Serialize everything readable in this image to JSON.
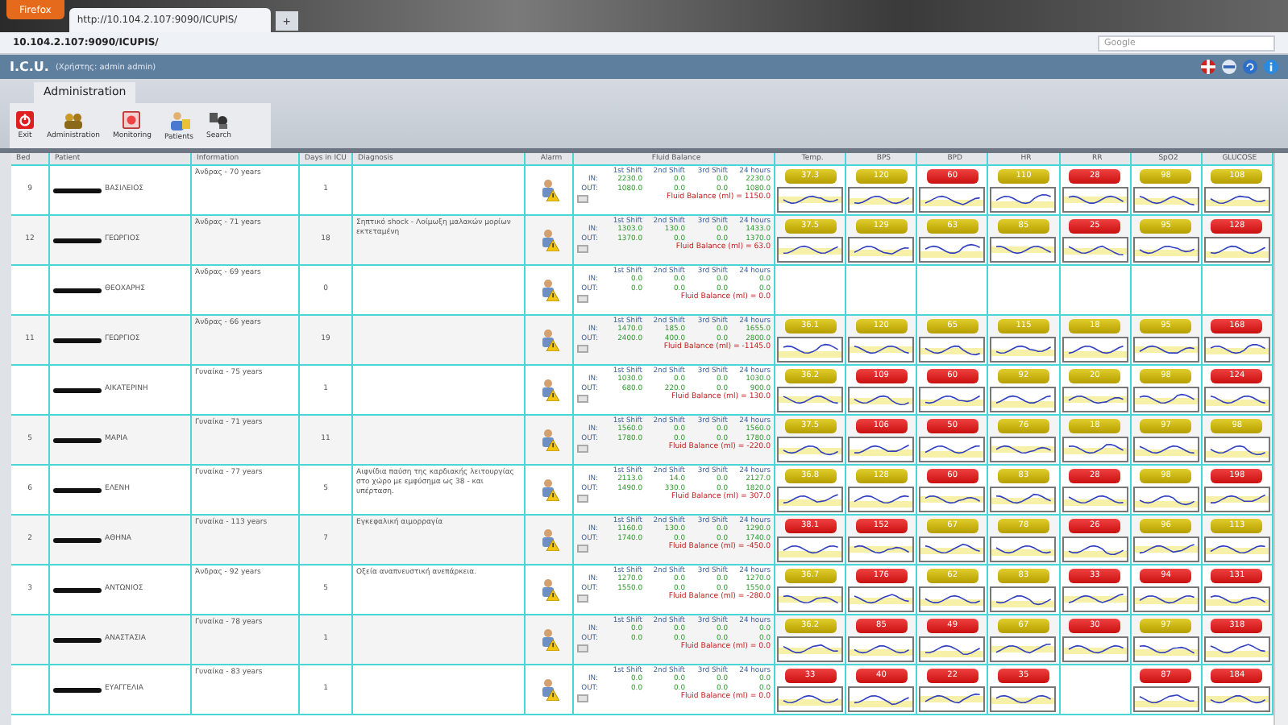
{
  "browser": {
    "menu_button": "Firefox",
    "tab_title": "http://10.104.2.107:9090/ICUPIS/",
    "new_tab": "+",
    "url": "10.104.2.107:9090/ICUPIS/",
    "search_placeholder": "Google"
  },
  "app": {
    "title": "I.C.U.",
    "user": "(Χρήστης: admin admin)"
  },
  "ribbon": {
    "tab": "Administration",
    "buttons": [
      {
        "label": "Exit",
        "kind": "exit"
      },
      {
        "label": "Administration",
        "kind": "admin"
      },
      {
        "label": "Monitoring",
        "kind": "monitoring"
      },
      {
        "label": "Patients",
        "kind": "patients"
      },
      {
        "label": "Search",
        "kind": "search"
      }
    ]
  },
  "table": {
    "columns": [
      "Bed",
      "Patient",
      "Information",
      "Days in ICU",
      "Diagnosis",
      "Alarm",
      "Fluid Balance",
      "Temp.",
      "BPS",
      "BPD",
      "HR",
      "RR",
      "SpO2",
      "GLUCOSE"
    ],
    "rows": [
      {
        "bed": "9",
        "patient": "ΒΑΣΙΛΕΙΟΣ",
        "info": "Άνδρας - 70 years",
        "days": "1",
        "fluid": {
          "shifts": [
            "1st Shift",
            "2nd Shift",
            "3rd Shift",
            "24 hours"
          ],
          "in_label": "IN:",
          "in": [
            "2230.0",
            "0.0",
            "0.0",
            "2230.0"
          ],
          "out_label": "OUT:",
          "out": [
            "1080.0",
            "0.0",
            "0.0",
            "1080.0"
          ],
          "balance": "Fluid Balance (ml) = 1150.0"
        },
        "vitals": {
          "temp": {
            "value": "37.3",
            "alert": false
          },
          "bps": {
            "value": "120",
            "alert": false
          },
          "bpd": {
            "value": "60",
            "alert": true
          },
          "hr": {
            "value": "110",
            "alert": false
          },
          "rr": {
            "value": "28",
            "alert": true
          },
          "spo2": {
            "value": "98",
            "alert": false
          },
          "glucose": {
            "value": "108",
            "alert": false
          }
        }
      },
      {
        "bed": "12",
        "patient": "ΓΕΩΡΓΙΟΣ",
        "info": "Άνδρας - 71 years",
        "days": "18",
        "diagnosis": "Σηπτικό shock - Λοίμωξη μαλακών μορίων εκτεταμένη",
        "fluid": {
          "shifts": [
            "1st Shift",
            "2nd Shift",
            "3rd Shift",
            "24 hours"
          ],
          "in_label": "IN:",
          "in": [
            "1303.0",
            "130.0",
            "0.0",
            "1433.0"
          ],
          "out_label": "OUT:",
          "out": [
            "1370.0",
            "0.0",
            "0.0",
            "1370.0"
          ],
          "balance": "Fluid Balance (ml) = 63.0"
        },
        "vitals": {
          "temp": {
            "value": "37.5",
            "alert": false
          },
          "bps": {
            "value": "129",
            "alert": false
          },
          "bpd": {
            "value": "63",
            "alert": false
          },
          "hr": {
            "value": "85",
            "alert": false
          },
          "rr": {
            "value": "25",
            "alert": true
          },
          "spo2": {
            "value": "95",
            "alert": false
          },
          "glucose": {
            "value": "128",
            "alert": true
          }
        }
      },
      {
        "patient": "ΘΕΟΧΑΡΗΣ",
        "info": "Άνδρας - 69 years",
        "days": "0",
        "fluid": {
          "shifts": [
            "1st Shift",
            "2nd Shift",
            "3rd Shift",
            "24 hours"
          ],
          "in_label": "IN:",
          "in": [
            "0.0",
            "0.0",
            "0.0",
            "0.0"
          ],
          "out_label": "OUT:",
          "out": [
            "0.0",
            "0.0",
            "0.0",
            "0.0"
          ],
          "balance": "Fluid Balance (ml) = 0.0"
        }
      },
      {
        "bed": "11",
        "patient": "ΓΕΩΡΓΙΟΣ",
        "info": "Άνδρας - 66 years",
        "days": "19",
        "fluid": {
          "shifts": [
            "1st Shift",
            "2nd Shift",
            "3rd Shift",
            "24 hours"
          ],
          "in_label": "IN:",
          "in": [
            "1470.0",
            "185.0",
            "0.0",
            "1655.0"
          ],
          "out_label": "OUT:",
          "out": [
            "2400.0",
            "400.0",
            "0.0",
            "2800.0"
          ],
          "balance": "Fluid Balance (ml) = -1145.0"
        },
        "vitals": {
          "temp": {
            "value": "36.1",
            "alert": false
          },
          "bps": {
            "value": "120",
            "alert": false
          },
          "bpd": {
            "value": "65",
            "alert": false
          },
          "hr": {
            "value": "115",
            "alert": false
          },
          "rr": {
            "value": "18",
            "alert": false
          },
          "spo2": {
            "value": "95",
            "alert": false
          },
          "glucose": {
            "value": "168",
            "alert": true
          }
        }
      },
      {
        "patient": "ΑΙΚΑΤΕΡΙΝΗ",
        "info": "Γυναίκα - 75 years",
        "days": "1",
        "fluid": {
          "shifts": [
            "1st Shift",
            "2nd Shift",
            "3rd Shift",
            "24 hours"
          ],
          "in_label": "IN:",
          "in": [
            "1030.0",
            "0.0",
            "0.0",
            "1030.0"
          ],
          "out_label": "OUT:",
          "out": [
            "680.0",
            "220.0",
            "0.0",
            "900.0"
          ],
          "balance": "Fluid Balance (ml) = 130.0"
        },
        "vitals": {
          "temp": {
            "value": "36.2",
            "alert": false
          },
          "bps": {
            "value": "109",
            "alert": true
          },
          "bpd": {
            "value": "60",
            "alert": true
          },
          "hr": {
            "value": "92",
            "alert": false
          },
          "rr": {
            "value": "20",
            "alert": false
          },
          "spo2": {
            "value": "98",
            "alert": false
          },
          "glucose": {
            "value": "124",
            "alert": true
          }
        }
      },
      {
        "bed": "5",
        "patient": "ΜΑΡΙΑ",
        "info": "Γυναίκα - 71 years",
        "days": "11",
        "fluid": {
          "shifts": [
            "1st Shift",
            "2nd Shift",
            "3rd Shift",
            "24 hours"
          ],
          "in_label": "IN:",
          "in": [
            "1560.0",
            "0.0",
            "0.0",
            "1560.0"
          ],
          "out_label": "OUT:",
          "out": [
            "1780.0",
            "0.0",
            "0.0",
            "1780.0"
          ],
          "balance": "Fluid Balance (ml) = -220.0"
        },
        "vitals": {
          "temp": {
            "value": "37.5",
            "alert": false
          },
          "bps": {
            "value": "106",
            "alert": true
          },
          "bpd": {
            "value": "50",
            "alert": true
          },
          "hr": {
            "value": "76",
            "alert": false
          },
          "rr": {
            "value": "18",
            "alert": false
          },
          "spo2": {
            "value": "97",
            "alert": false
          },
          "glucose": {
            "value": "98",
            "alert": false
          }
        }
      },
      {
        "bed": "6",
        "patient": "ΕΛΕΝΗ",
        "info": "Γυναίκα - 77 years",
        "days": "5",
        "diagnosis": "Αιφνίδια παύση της καρδιακής λειτουργίας στο χώρο με εμφύσημα ως 38 - και υπέρταση.",
        "fluid": {
          "shifts": [
            "1st Shift",
            "2nd Shift",
            "3rd Shift",
            "24 hours"
          ],
          "in_label": "IN:",
          "in": [
            "2113.0",
            "14.0",
            "0.0",
            "2127.0"
          ],
          "out_label": "OUT:",
          "out": [
            "1490.0",
            "330.0",
            "0.0",
            "1820.0"
          ],
          "balance": "Fluid Balance (ml) = 307.0"
        },
        "vitals": {
          "temp": {
            "value": "36.8",
            "alert": false
          },
          "bps": {
            "value": "128",
            "alert": false
          },
          "bpd": {
            "value": "60",
            "alert": true
          },
          "hr": {
            "value": "83",
            "alert": false
          },
          "rr": {
            "value": "28",
            "alert": true
          },
          "spo2": {
            "value": "98",
            "alert": false
          },
          "glucose": {
            "value": "198",
            "alert": true
          }
        }
      },
      {
        "bed": "2",
        "patient": "ΑΘΗΝΑ",
        "info": "Γυναίκα - 113 years",
        "days": "7",
        "diagnosis": "Εγκεφαλική αιμορραγία",
        "fluid": {
          "shifts": [
            "1st Shift",
            "2nd Shift",
            "3rd Shift",
            "24 hours"
          ],
          "in_label": "IN:",
          "in": [
            "1160.0",
            "130.0",
            "0.0",
            "1290.0"
          ],
          "out_label": "OUT:",
          "out": [
            "1740.0",
            "0.0",
            "0.0",
            "1740.0"
          ],
          "balance": "Fluid Balance (ml) = -450.0"
        },
        "vitals": {
          "temp": {
            "value": "38.1",
            "alert": true
          },
          "bps": {
            "value": "152",
            "alert": true
          },
          "bpd": {
            "value": "67",
            "alert": false
          },
          "hr": {
            "value": "78",
            "alert": false
          },
          "rr": {
            "value": "26",
            "alert": true
          },
          "spo2": {
            "value": "96",
            "alert": false
          },
          "glucose": {
            "value": "113",
            "alert": false
          }
        }
      },
      {
        "bed": "3",
        "patient": "ΑΝΤΩΝΙΟΣ",
        "info": "Άνδρας - 92 years",
        "days": "5",
        "diagnosis": "Οξεία αναπνευστική ανεπάρκεια.",
        "fluid": {
          "shifts": [
            "1st Shift",
            "2nd Shift",
            "3rd Shift",
            "24 hours"
          ],
          "in_label": "IN:",
          "in": [
            "1270.0",
            "0.0",
            "0.0",
            "1270.0"
          ],
          "out_label": "OUT:",
          "out": [
            "1550.0",
            "0.0",
            "0.0",
            "1550.0"
          ],
          "balance": "Fluid Balance (ml) = -280.0"
        },
        "vitals": {
          "temp": {
            "value": "36.7",
            "alert": false
          },
          "bps": {
            "value": "176",
            "alert": true
          },
          "bpd": {
            "value": "62",
            "alert": false
          },
          "hr": {
            "value": "83",
            "alert": false
          },
          "rr": {
            "value": "33",
            "alert": true
          },
          "spo2": {
            "value": "94",
            "alert": true
          },
          "glucose": {
            "value": "131",
            "alert": true
          }
        }
      },
      {
        "patient": "ΑΝΑΣΤΑΣΙΑ",
        "info": "Γυναίκα - 78 years",
        "days": "1",
        "fluid": {
          "shifts": [
            "1st Shift",
            "2nd Shift",
            "3rd Shift",
            "24 hours"
          ],
          "in_label": "IN:",
          "in": [
            "0.0",
            "0.0",
            "0.0",
            "0.0"
          ],
          "out_label": "OUT:",
          "out": [
            "0.0",
            "0.0",
            "0.0",
            "0.0"
          ],
          "balance": "Fluid Balance (ml) = 0.0"
        },
        "vitals": {
          "temp": {
            "value": "36.2",
            "alert": false
          },
          "bps": {
            "value": "85",
            "alert": true
          },
          "bpd": {
            "value": "49",
            "alert": true
          },
          "hr": {
            "value": "67",
            "alert": false
          },
          "rr": {
            "value": "30",
            "alert": true
          },
          "spo2": {
            "value": "97",
            "alert": false
          },
          "glucose": {
            "value": "318",
            "alert": true
          }
        }
      },
      {
        "patient": "ΕΥΑΓΓΕΛΙΑ",
        "info": "Γυναίκα - 83 years",
        "days": "1",
        "fluid": {
          "shifts": [
            "1st Shift",
            "2nd Shift",
            "3rd Shift",
            "24 hours"
          ],
          "in_label": "IN:",
          "in": [
            "0.0",
            "0.0",
            "0.0",
            "0.0"
          ],
          "out_label": "OUT:",
          "out": [
            "0.0",
            "0.0",
            "0.0",
            "0.0"
          ],
          "balance": "Fluid Balance (ml) = 0.0"
        },
        "vitals": {
          "temp": {
            "value": "33",
            "alert": true
          },
          "bps": {
            "value": "40",
            "alert": true
          },
          "bpd": {
            "value": "22",
            "alert": true
          },
          "hr": {
            "value": "35",
            "alert": true
          },
          "spo2": {
            "value": "87",
            "alert": true
          },
          "glucose": {
            "value": "184",
            "alert": true
          }
        }
      }
    ]
  }
}
